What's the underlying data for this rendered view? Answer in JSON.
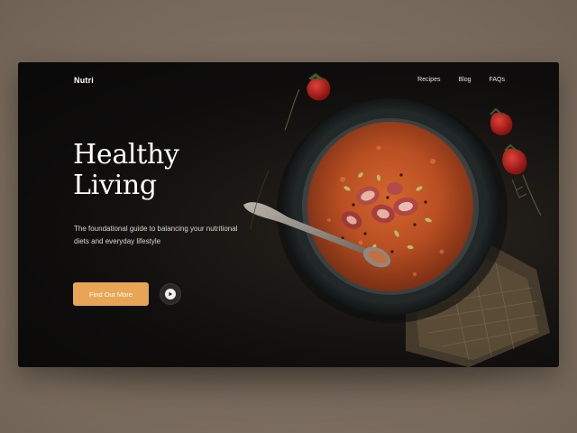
{
  "app": {
    "brand": "Nutri"
  },
  "nav": {
    "items": [
      {
        "label": "Recipes"
      },
      {
        "label": "Blog"
      },
      {
        "label": "FAQs"
      }
    ]
  },
  "hero": {
    "title_line1": "Healthy",
    "title_line2": "Living",
    "subtitle": "The foundational guide to balancing your nutritional diets and everyday lifestyle",
    "cta_label": "Find Out More",
    "play_icon": "play-icon"
  },
  "colors": {
    "accent": "#e8a555",
    "background": "#7d6e60",
    "card": "#0c0b0a",
    "text": "#ffffff"
  }
}
